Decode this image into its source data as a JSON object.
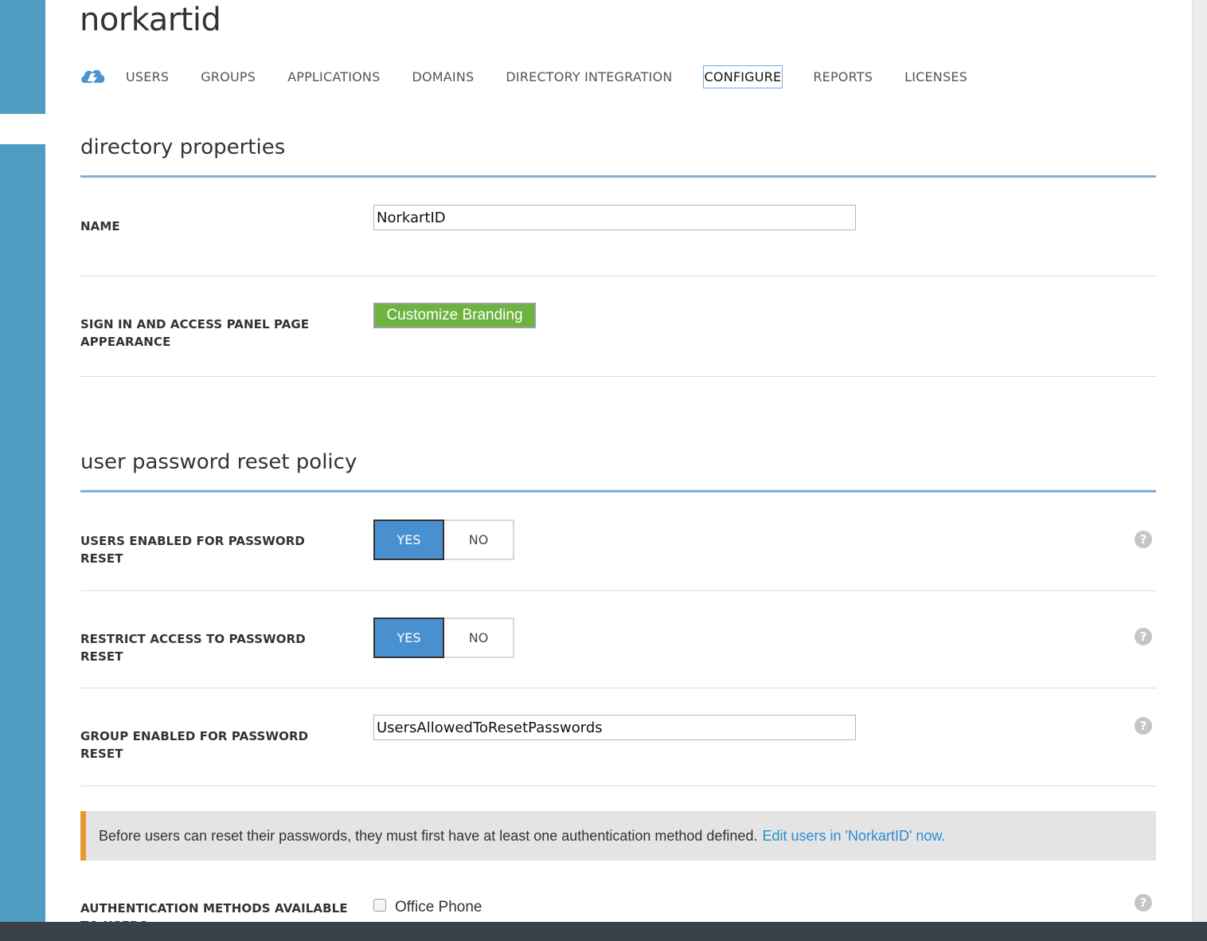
{
  "header": {
    "directory_title": "norkartid"
  },
  "nav": {
    "items": [
      {
        "label": "USERS"
      },
      {
        "label": "GROUPS"
      },
      {
        "label": "APPLICATIONS"
      },
      {
        "label": "DOMAINS"
      },
      {
        "label": "DIRECTORY INTEGRATION"
      },
      {
        "label": "CONFIGURE"
      },
      {
        "label": "REPORTS"
      },
      {
        "label": "LICENSES"
      }
    ],
    "active": "CONFIGURE",
    "logo_icon": "azure-cloud-icon"
  },
  "directory_properties": {
    "title": "directory properties",
    "name_label": "NAME",
    "name_value": "NorkartID",
    "appearance_label": "SIGN IN AND ACCESS PANEL PAGE APPEARANCE",
    "branding_button": "Customize Branding"
  },
  "password_reset_policy": {
    "title": "user password reset policy",
    "users_enabled": {
      "label": "USERS ENABLED FOR PASSWORD RESET",
      "yes": "YES",
      "no": "NO",
      "selected": "YES"
    },
    "restrict_access": {
      "label": "RESTRICT ACCESS TO PASSWORD RESET",
      "yes": "YES",
      "no": "NO",
      "selected": "YES"
    },
    "group_enabled": {
      "label": "GROUP ENABLED FOR PASSWORD RESET",
      "value": "UsersAllowedToResetPasswords"
    },
    "notice": {
      "text": "Before users can reset their passwords, they must first have at least one authentication method defined.",
      "link": "Edit users in 'NorkartID' now."
    },
    "auth_methods": {
      "label": "AUTHENTICATION METHODS AVAILABLE TO USERS",
      "option_office_phone": "Office Phone",
      "office_phone_checked": false
    },
    "help_glyph": "?"
  },
  "colors": {
    "side_strip": "#4f9dc0",
    "accent_blue": "#4990d0",
    "branding_green": "#6db33f",
    "notice_border": "#e39a33",
    "link": "#2a8dd2",
    "bottom_bar": "#3a4148"
  }
}
